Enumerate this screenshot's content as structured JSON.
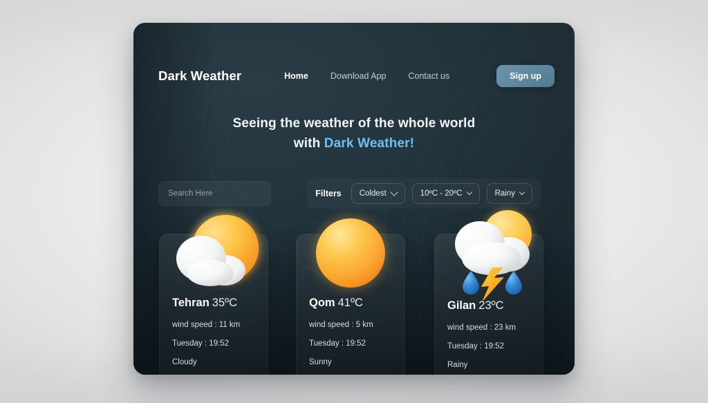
{
  "theme": {
    "panel_bg": "#23343d",
    "accent": "#6ec1ef",
    "signup_bg": "#5f8aa1",
    "sun_light": "#ffd966",
    "sun_deep": "#f5881d",
    "rain_blue": "#2c7fd6",
    "bolt_amber": "#f9a21b",
    "page_bg": "#e9e9e9"
  },
  "nav": {
    "brand": "Dark Weather",
    "links": [
      {
        "label": "Home",
        "active": true
      },
      {
        "label": "Download App",
        "active": false
      },
      {
        "label": "Contact us",
        "active": false
      }
    ],
    "signup_label": "Sign up"
  },
  "hero": {
    "line1": "Seeing the weather of the whole world",
    "line2_prefix": "with ",
    "line2_accent": "Dark Weather!"
  },
  "search": {
    "placeholder": "Search Here",
    "value": ""
  },
  "filters": {
    "label": "Filters",
    "chips": [
      {
        "value": "Coldest",
        "icon": "chevron-down-icon",
        "size": "lg"
      },
      {
        "value": "10ºC - 20ºC",
        "icon": "chevron-down-icon",
        "size": "sm"
      },
      {
        "value": "Rainy",
        "icon": "chevron-down-icon",
        "size": "sm"
      }
    ]
  },
  "cards": [
    {
      "city": "Tehran",
      "temp": "35ºC",
      "wind": "wind speed : 11 km",
      "time": "Tuesday : 19:52",
      "condition": "Cloudy",
      "icon": "sun-behind-cloud-icon"
    },
    {
      "city": "Qom",
      "temp": "41ºC",
      "wind": "wind speed : 5 km",
      "time": "Tuesday : 19:52",
      "condition": "Sunny",
      "icon": "sun-icon"
    },
    {
      "city": "Gilan",
      "temp": "23ºC",
      "wind": "wind speed : 23 km",
      "time": "Tuesday : 19:52",
      "condition": "Rainy",
      "icon": "thunderstorm-rain-icon"
    }
  ]
}
